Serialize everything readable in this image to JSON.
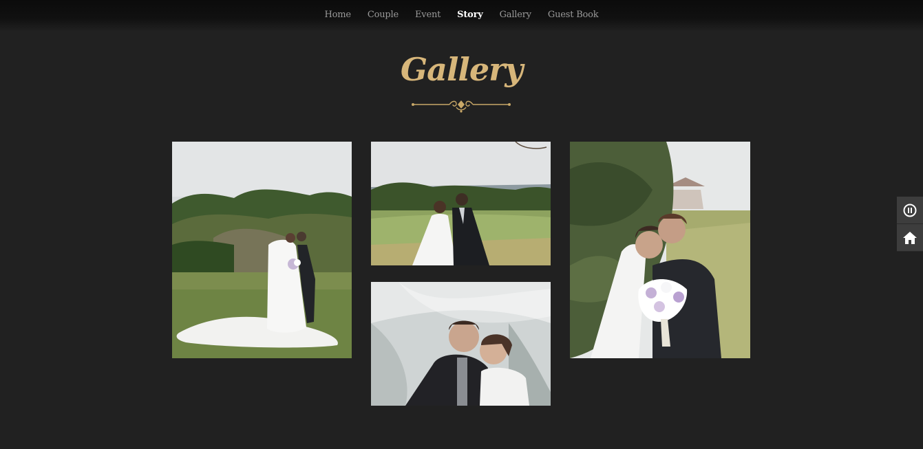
{
  "nav": {
    "items": [
      {
        "label": "Home",
        "active": false
      },
      {
        "label": "Couple",
        "active": false
      },
      {
        "label": "Event",
        "active": false
      },
      {
        "label": "Story",
        "active": true
      },
      {
        "label": "Gallery",
        "active": false
      },
      {
        "label": "Guest Book",
        "active": false
      }
    ]
  },
  "gallery": {
    "title": "Gallery",
    "photos": [
      {
        "name": "gallery-photo-couple-hillside-veil"
      },
      {
        "name": "gallery-photo-couple-golf-course"
      },
      {
        "name": "gallery-photo-couple-under-veil"
      },
      {
        "name": "gallery-photo-couple-bouquet-closeup"
      }
    ]
  },
  "controls": {
    "pause_icon": "pause-icon",
    "home_icon": "home-icon"
  },
  "colors": {
    "background": "#212121",
    "accent_gold": "#d7b67a",
    "nav_text": "#9a9a9a",
    "nav_active": "#ffffff"
  }
}
